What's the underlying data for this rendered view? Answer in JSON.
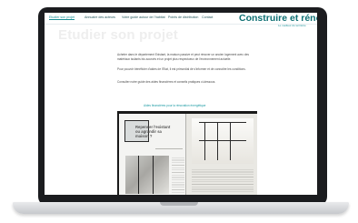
{
  "nav": {
    "items": [
      "Etudier son projet",
      "Annuaire des acteurs",
      "Votre guide autour de l'habitat",
      "Points de distribution",
      "Contact"
    ]
  },
  "site": {
    "title": "Construire et rénover au Lu",
    "subtitle": "Le meilleur du territoire"
  },
  "hero": {
    "title": "Etudier son projet"
  },
  "content": {
    "paragraph1": "Acheter dans le département Existant, la maison passive et peut rénover un ancien logement avec des matériaux isolants bio-sourcés et un projet plus respectueux de l'environnement actuelle.",
    "paragraph2": "Pour pouvoir bénéficier d'aides de l'Etat, il est primordial de s'informer et de connaître les conditions.",
    "paragraph3": "Consulter notre guide des aides financières et conseils pratiques ci-dessous.",
    "link": "Aides financières pour la rénovation énergétique"
  },
  "magazine": {
    "headline": "Repenser l'existant ou agrandir sa maison ?"
  },
  "colors": {
    "brand": "#0e6f73",
    "accent": "#1b8f96",
    "link": "#1b9aa3"
  }
}
